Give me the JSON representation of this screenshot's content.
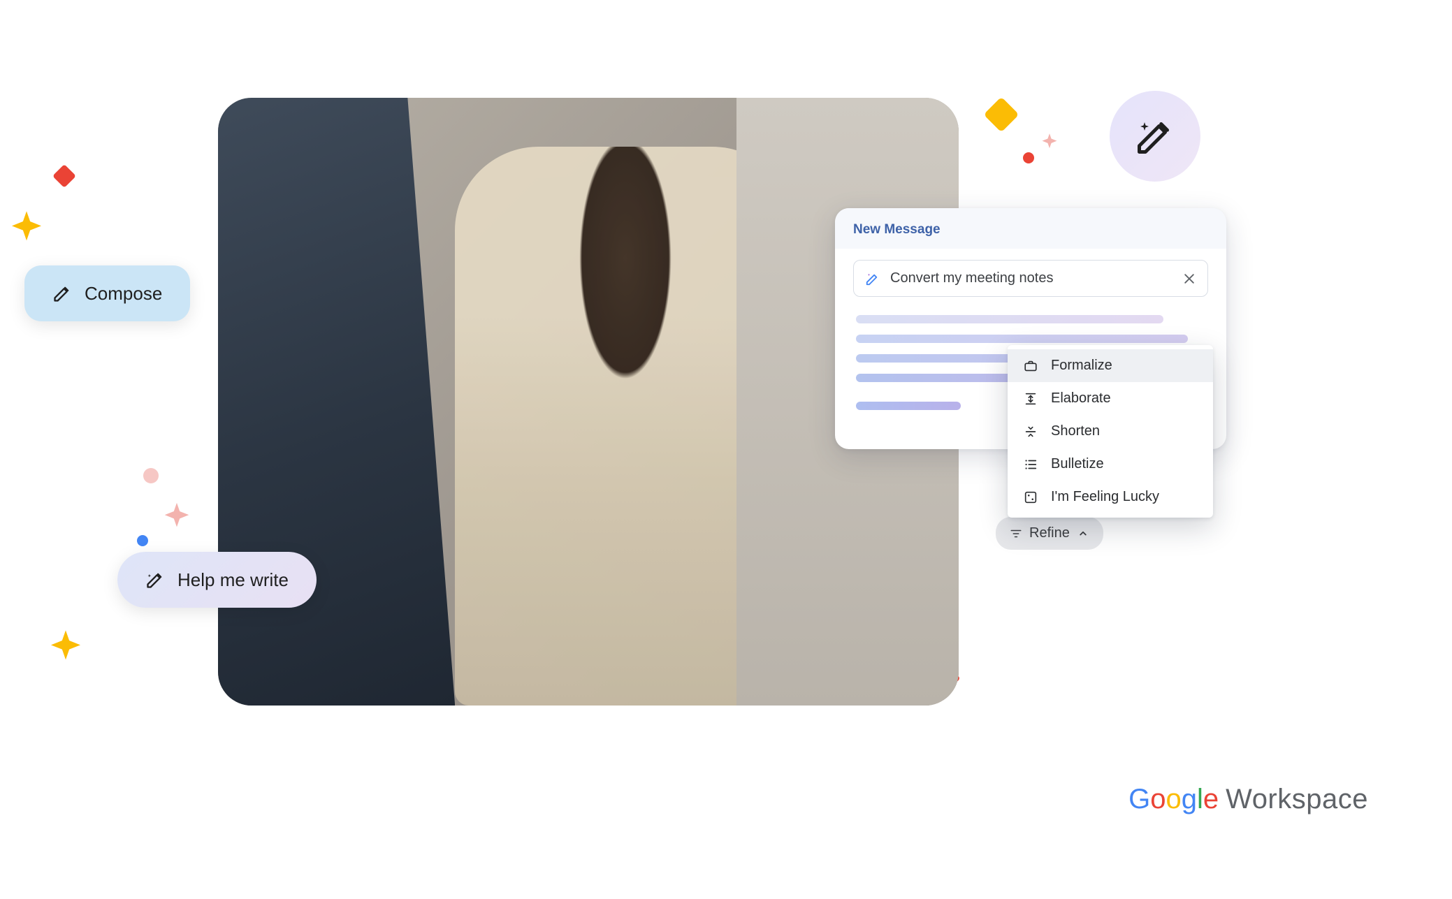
{
  "pills": {
    "compose": "Compose",
    "help": "Help me write"
  },
  "panel": {
    "title": "New Message",
    "prompt": "Convert my meeting notes"
  },
  "menu": {
    "items": [
      {
        "label": "Formalize"
      },
      {
        "label": "Elaborate"
      },
      {
        "label": "Shorten"
      },
      {
        "label": "Bulletize"
      },
      {
        "label": "I'm Feeling Lucky"
      }
    ]
  },
  "refine": {
    "label": "Refine"
  },
  "brand": {
    "google": {
      "G": "G",
      "o1": "o",
      "o2": "o",
      "g": "g",
      "l": "l",
      "e": "e"
    },
    "workspace": "Workspace"
  },
  "colors": {
    "blue": "#4285F4",
    "red": "#EA4335",
    "yellow": "#FBBC05",
    "green": "#34A853"
  }
}
